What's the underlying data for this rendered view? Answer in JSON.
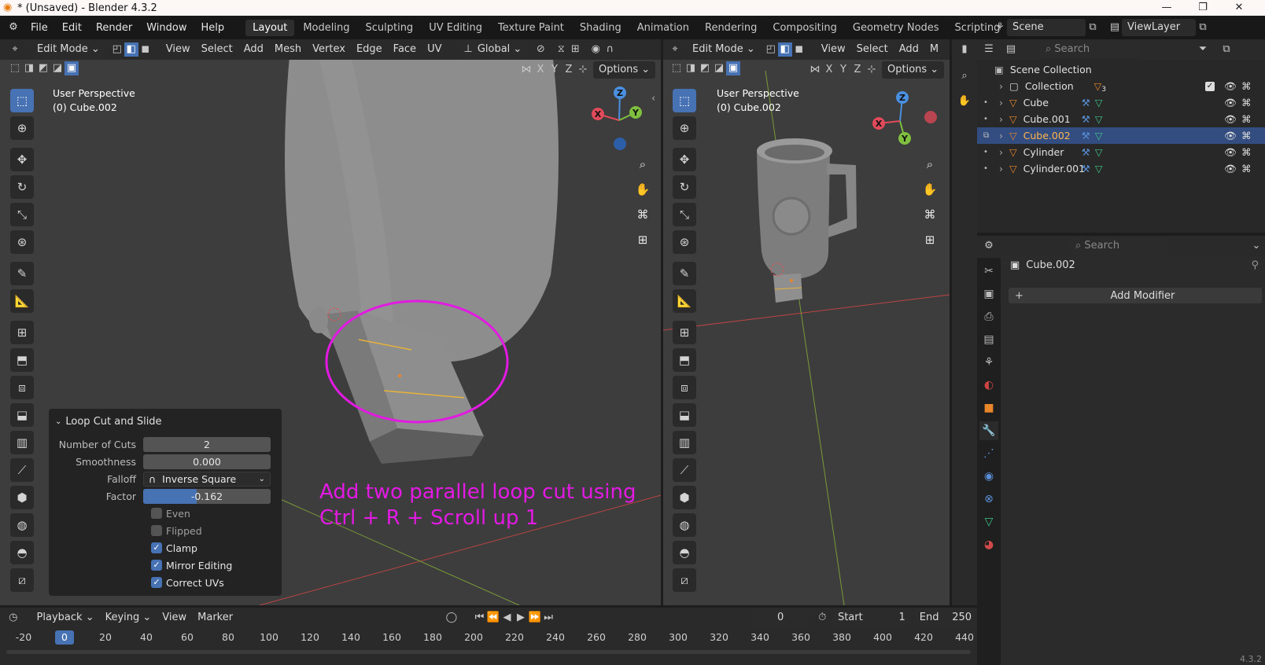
{
  "window": {
    "title": "* (Unsaved) - Blender 4.3.2",
    "minimize": "—",
    "maximize": "❐",
    "close": "✕"
  },
  "menu": [
    "File",
    "Edit",
    "Render",
    "Window",
    "Help"
  ],
  "tabs": [
    {
      "label": "Layout",
      "active": true
    },
    {
      "label": "Modeling"
    },
    {
      "label": "Sculpting"
    },
    {
      "label": "UV Editing"
    },
    {
      "label": "Texture Paint"
    },
    {
      "label": "Shading"
    },
    {
      "label": "Animation"
    },
    {
      "label": "Rendering"
    },
    {
      "label": "Compositing"
    },
    {
      "label": "Geometry Nodes"
    },
    {
      "label": "Scripting"
    },
    {
      "label": "+"
    }
  ],
  "scene": {
    "name": "Scene",
    "view_layer": "ViewLayer"
  },
  "vp1": {
    "mode": "Edit Mode",
    "menus": [
      "View",
      "Select",
      "Add",
      "Mesh",
      "Vertex",
      "Edge",
      "Face",
      "UV"
    ],
    "orientation": "Global",
    "options": "Options",
    "axes": [
      "X",
      "Y",
      "Z"
    ],
    "perspective": "User Perspective",
    "object": "(0) Cube.002"
  },
  "vp2": {
    "mode": "Edit Mode",
    "menus": [
      "View",
      "Select",
      "Add",
      "M"
    ],
    "options": "Options",
    "axes": [
      "X",
      "Y",
      "Z"
    ],
    "perspective": "User Perspective",
    "object": "(0) Cube.002"
  },
  "gizmo": {
    "x": "X",
    "y": "Y",
    "z": "Z"
  },
  "annotation": {
    "line1": "Add two parallel loop cut using",
    "line2": "Ctrl + R + Scroll up 1",
    "color": "#e21ae2"
  },
  "loopcut": {
    "title": "Loop Cut and Slide",
    "number_of_cuts": {
      "label": "Number of Cuts",
      "value": "2"
    },
    "smoothness": {
      "label": "Smoothness",
      "value": "0.000"
    },
    "falloff": {
      "label": "Falloff",
      "value": "Inverse Square"
    },
    "factor": {
      "label": "Factor",
      "value": "-0.162"
    },
    "even": {
      "label": "Even",
      "checked": false
    },
    "flipped": {
      "label": "Flipped",
      "checked": false
    },
    "clamp": {
      "label": "Clamp",
      "checked": true
    },
    "mirror": {
      "label": "Mirror Editing",
      "checked": true
    },
    "correct_uvs": {
      "label": "Correct UVs",
      "checked": true
    }
  },
  "outliner": {
    "search": "Search",
    "root": "Scene Collection",
    "collection": {
      "label": "Collection",
      "count": "3"
    },
    "items": [
      {
        "label": "Cube",
        "selected": false
      },
      {
        "label": "Cube.001",
        "selected": false
      },
      {
        "label": "Cube.002",
        "selected": true
      },
      {
        "label": "Cylinder",
        "selected": false
      },
      {
        "label": "Cylinder.001",
        "selected": false
      }
    ]
  },
  "properties": {
    "search": "Search",
    "object": "Cube.002",
    "add_modifier": "Add Modifier"
  },
  "timeline": {
    "menus": [
      "Playback",
      "Keying",
      "View",
      "Marker"
    ],
    "current_frame": "0",
    "start_label": "Start",
    "start": "1",
    "end_label": "End",
    "end": "250",
    "ticks": [
      "-20",
      "0",
      "20",
      "40",
      "60",
      "80",
      "100",
      "120",
      "140",
      "160",
      "180",
      "200",
      "220",
      "240",
      "260",
      "280",
      "300",
      "320",
      "340",
      "360",
      "380",
      "400",
      "420",
      "440"
    ]
  },
  "version": "4.3.2"
}
